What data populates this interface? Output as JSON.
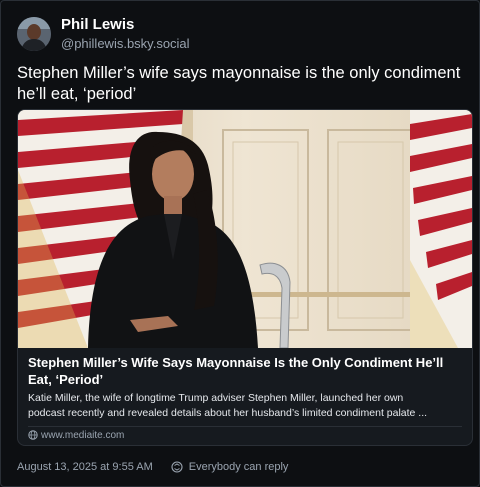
{
  "post": {
    "author_name": "Phil Lewis",
    "author_handle": "@phillewis.bsky.social",
    "text": "Stephen Miller’s wife says mayonnaise is the only condiment he’ll eat, ‘period’",
    "date": "August 13, 2025 at 9:55 AM",
    "reply_setting": "Everybody can reply"
  },
  "link_card": {
    "title": "Stephen Miller’s Wife Says Mayonnaise Is the Only Condiment He’ll Eat, ‘Period’",
    "description_line1": "Katie Miller, the wife of longtime Trump adviser Stephen Miller, launched her own",
    "description_line2": "podcast recently and revealed details about her husband’s limited condiment palate ...",
    "domain": "www.mediaite.com"
  },
  "icons": {
    "link": "globe-icon",
    "reply_setting": "reply-setting-icon"
  },
  "colors": {
    "background": "#0d0f12",
    "text_primary": "#ffffff",
    "text_secondary": "#9aa4b0",
    "border": "#2a2f36"
  }
}
